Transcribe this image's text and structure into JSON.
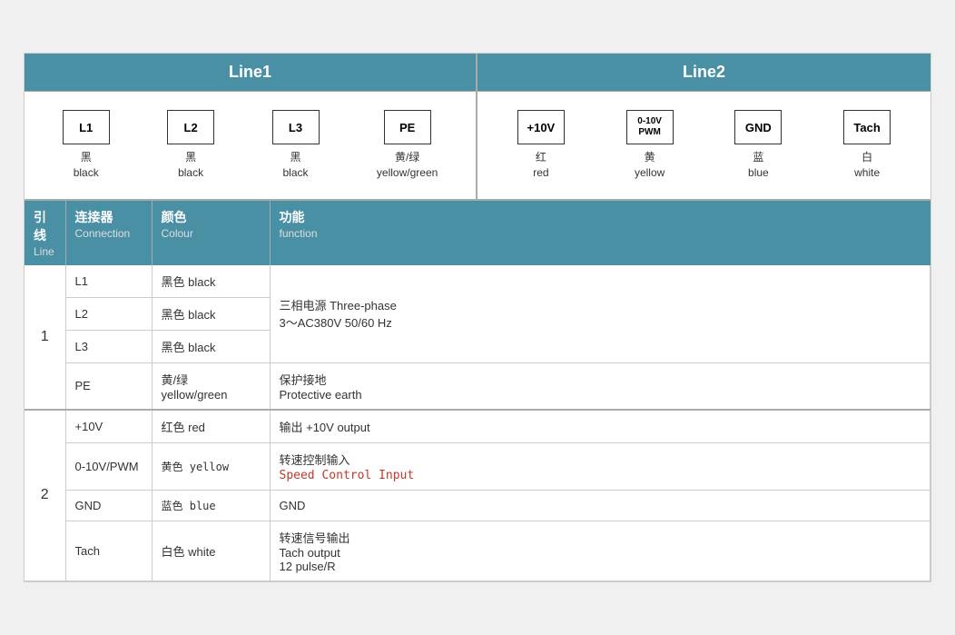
{
  "header": {
    "line1_label": "Line1",
    "line2_label": "Line2"
  },
  "line1_connectors": [
    {
      "id": "L1",
      "zh": "黑",
      "en": "black"
    },
    {
      "id": "L2",
      "zh": "黑",
      "en": "black"
    },
    {
      "id": "L3",
      "zh": "黑",
      "en": "black"
    },
    {
      "id": "PE",
      "zh": "黄/绿",
      "en": "yellow/green"
    }
  ],
  "line2_connectors": [
    {
      "id": "+10V",
      "zh": "红",
      "en": "red"
    },
    {
      "id": "0-10V\nPWM",
      "zh": "黄",
      "en": "yellow"
    },
    {
      "id": "GND",
      "zh": "蓝",
      "en": "blue"
    },
    {
      "id": "Tach",
      "zh": "白",
      "en": "white"
    }
  ],
  "table": {
    "headers": [
      {
        "zh": "引线",
        "en": "Line"
      },
      {
        "zh": "连接器",
        "en": "Connection"
      },
      {
        "zh": "颜色",
        "en": "Colour"
      },
      {
        "zh": "功能",
        "en": "function"
      }
    ],
    "rows": [
      {
        "line": "1",
        "rowspan": 4,
        "entries": [
          {
            "conn": "L1",
            "color_zh": "黑色 black",
            "func_zh": "三相电源 Three-phase",
            "func_en": "3～AC380V 50/60 Hz",
            "func_en2": ""
          },
          {
            "conn": "L2",
            "color_zh": "黑色 black",
            "func_zh": "",
            "func_en": "",
            "func_en2": ""
          },
          {
            "conn": "L3",
            "color_zh": "黑色 black",
            "func_zh": "",
            "func_en": "",
            "func_en2": ""
          },
          {
            "conn": "PE",
            "color_zh": "黄/绿\nyellow/green",
            "func_zh": "保护接地",
            "func_en": "Protective earth",
            "func_en2": ""
          }
        ]
      },
      {
        "line": "2",
        "rowspan": 4,
        "entries": [
          {
            "conn": "+10V",
            "color_zh": "红色 red",
            "func_zh": "输出 +10V output",
            "func_en": "",
            "func_en2": ""
          },
          {
            "conn": "0-10V/PWM",
            "color_zh": "黄色 yellow",
            "func_zh": "转速控制输入",
            "func_en": "Speed Control Input",
            "func_en2": ""
          },
          {
            "conn": "GND",
            "color_zh": "蓝色 blue",
            "func_zh": "GND",
            "func_en": "",
            "func_en2": ""
          },
          {
            "conn": "Tach",
            "color_zh": "白色 white",
            "func_zh": "转速信号输出",
            "func_en": "Tach output",
            "func_en2": "12 pulse/R"
          }
        ]
      }
    ]
  }
}
